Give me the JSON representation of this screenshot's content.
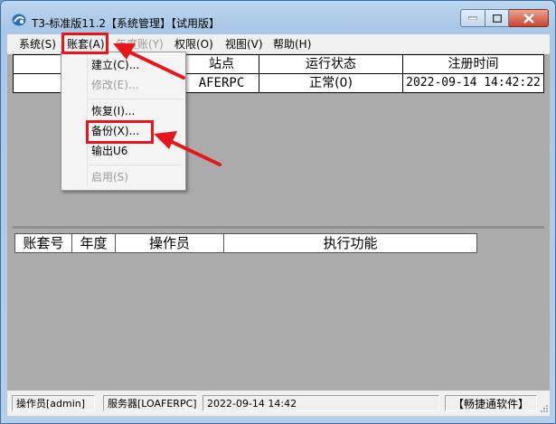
{
  "window": {
    "title": "T3-标准版11.2【系统管理】【试用版】"
  },
  "menubar": {
    "items": [
      {
        "label": "系统(S)",
        "enabled": true
      },
      {
        "label": "账套(A)",
        "enabled": true
      },
      {
        "label": "年度账(Y)",
        "enabled": false
      },
      {
        "label": "权限(O)",
        "enabled": true
      },
      {
        "label": "视图(V)",
        "enabled": true
      },
      {
        "label": "帮助(H)",
        "enabled": true
      }
    ]
  },
  "account_menu": {
    "items": [
      {
        "label": "建立(C)...",
        "enabled": true
      },
      {
        "label": "修改(E)...",
        "enabled": false
      },
      {
        "label": "恢复(I)...",
        "enabled": true
      },
      {
        "label": "备份(X)...",
        "enabled": true
      },
      {
        "label": "输出U6",
        "enabled": true
      },
      {
        "label": "启用(S)",
        "enabled": false
      }
    ]
  },
  "site_table": {
    "headers": [
      "站点",
      "运行状态",
      "注册时间"
    ],
    "rows": [
      {
        "site": "AFERPC",
        "status": "正常(0)",
        "registered": "2022-09-14 14:42:22"
      }
    ]
  },
  "task_table": {
    "headers": [
      "账套号",
      "年度",
      "操作员",
      "执行功能"
    ]
  },
  "statusbar": {
    "operator": "操作员[admin]",
    "server": "服务器[LOAFERPC]",
    "datetime": "2022-09-14 14:42",
    "brand": "【畅捷通软件】"
  },
  "colors": {
    "annotation": "#e8161b",
    "client_background": "#ababab"
  }
}
